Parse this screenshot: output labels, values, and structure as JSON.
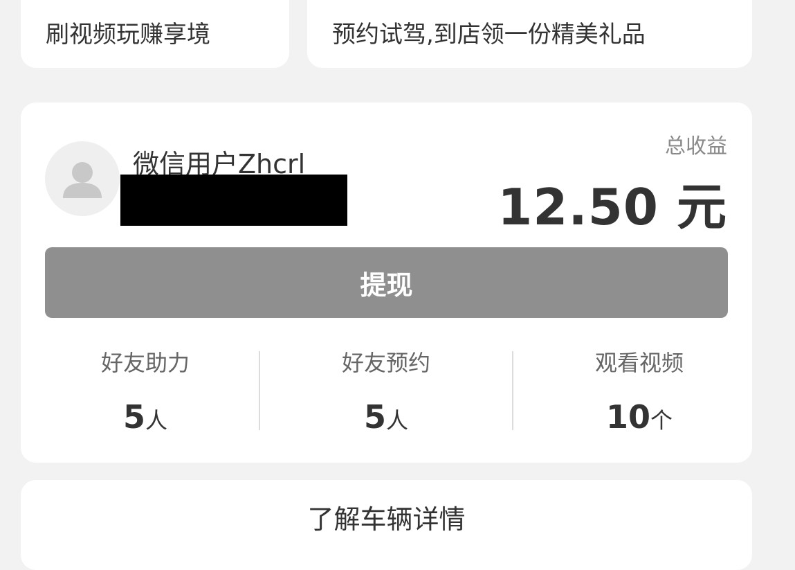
{
  "top_cards": {
    "left_text": "刷视频玩赚享境",
    "right_text": "预约试驾,到店领一份精美礼品"
  },
  "profile": {
    "username": "微信用户Zhcrl",
    "avatar_icon": "user-avatar-icon"
  },
  "income": {
    "label": "总收益",
    "amount": "12.50 元"
  },
  "withdraw": {
    "label": "提现",
    "bg_color": "#8f8f8f"
  },
  "stats": [
    {
      "label": "好友助力",
      "value": "5",
      "unit": "人"
    },
    {
      "label": "好友预约",
      "value": "5",
      "unit": "人"
    },
    {
      "label": "观看视频",
      "value": "10",
      "unit": "个"
    }
  ],
  "bottom": {
    "label": "了解车辆详情"
  }
}
